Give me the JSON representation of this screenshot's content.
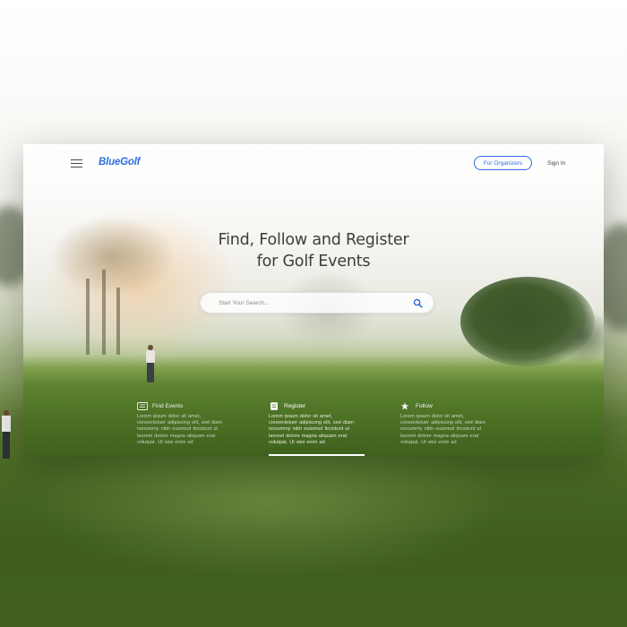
{
  "header": {
    "logo": "BlueGolf",
    "organizers_button": "For Organizers",
    "sign_in": "Sign In"
  },
  "hero": {
    "title_line1": "Find, Follow and Register",
    "title_line2": "for Golf Events"
  },
  "search": {
    "placeholder": "Start Your Search..."
  },
  "features": [
    {
      "icon": "ticket-icon",
      "title": "Find Events",
      "body": "Lorem ipsum dolor sit amet, consectetuer adipiscing elit, sed diam nonummy nibh euismod tincidunt ut laoreet dolore magna aliquam erat volutpat. Ut wisi enim ad"
    },
    {
      "icon": "clipboard-icon",
      "title": "Register",
      "body": "Lorem ipsum dolor sit amet, consectetuer adipiscing elit, sed diam nonummy nibh euismod tincidunt ut laoreet dolore magna aliquam erat volutpat. Ut wisi enim ad"
    },
    {
      "icon": "star-icon",
      "title": "Follow",
      "body": "Lorem ipsum dolor sit amet, consectetuer adipiscing elit, sed diam nonummy nibh euismod tincidunt ut laoreet dolore magna aliquam erat volutpat. Ut wisi enim ad"
    }
  ],
  "active_feature": "Register",
  "colors": {
    "brand": "#2f6fe0",
    "title_text": "#3d3d3d"
  }
}
